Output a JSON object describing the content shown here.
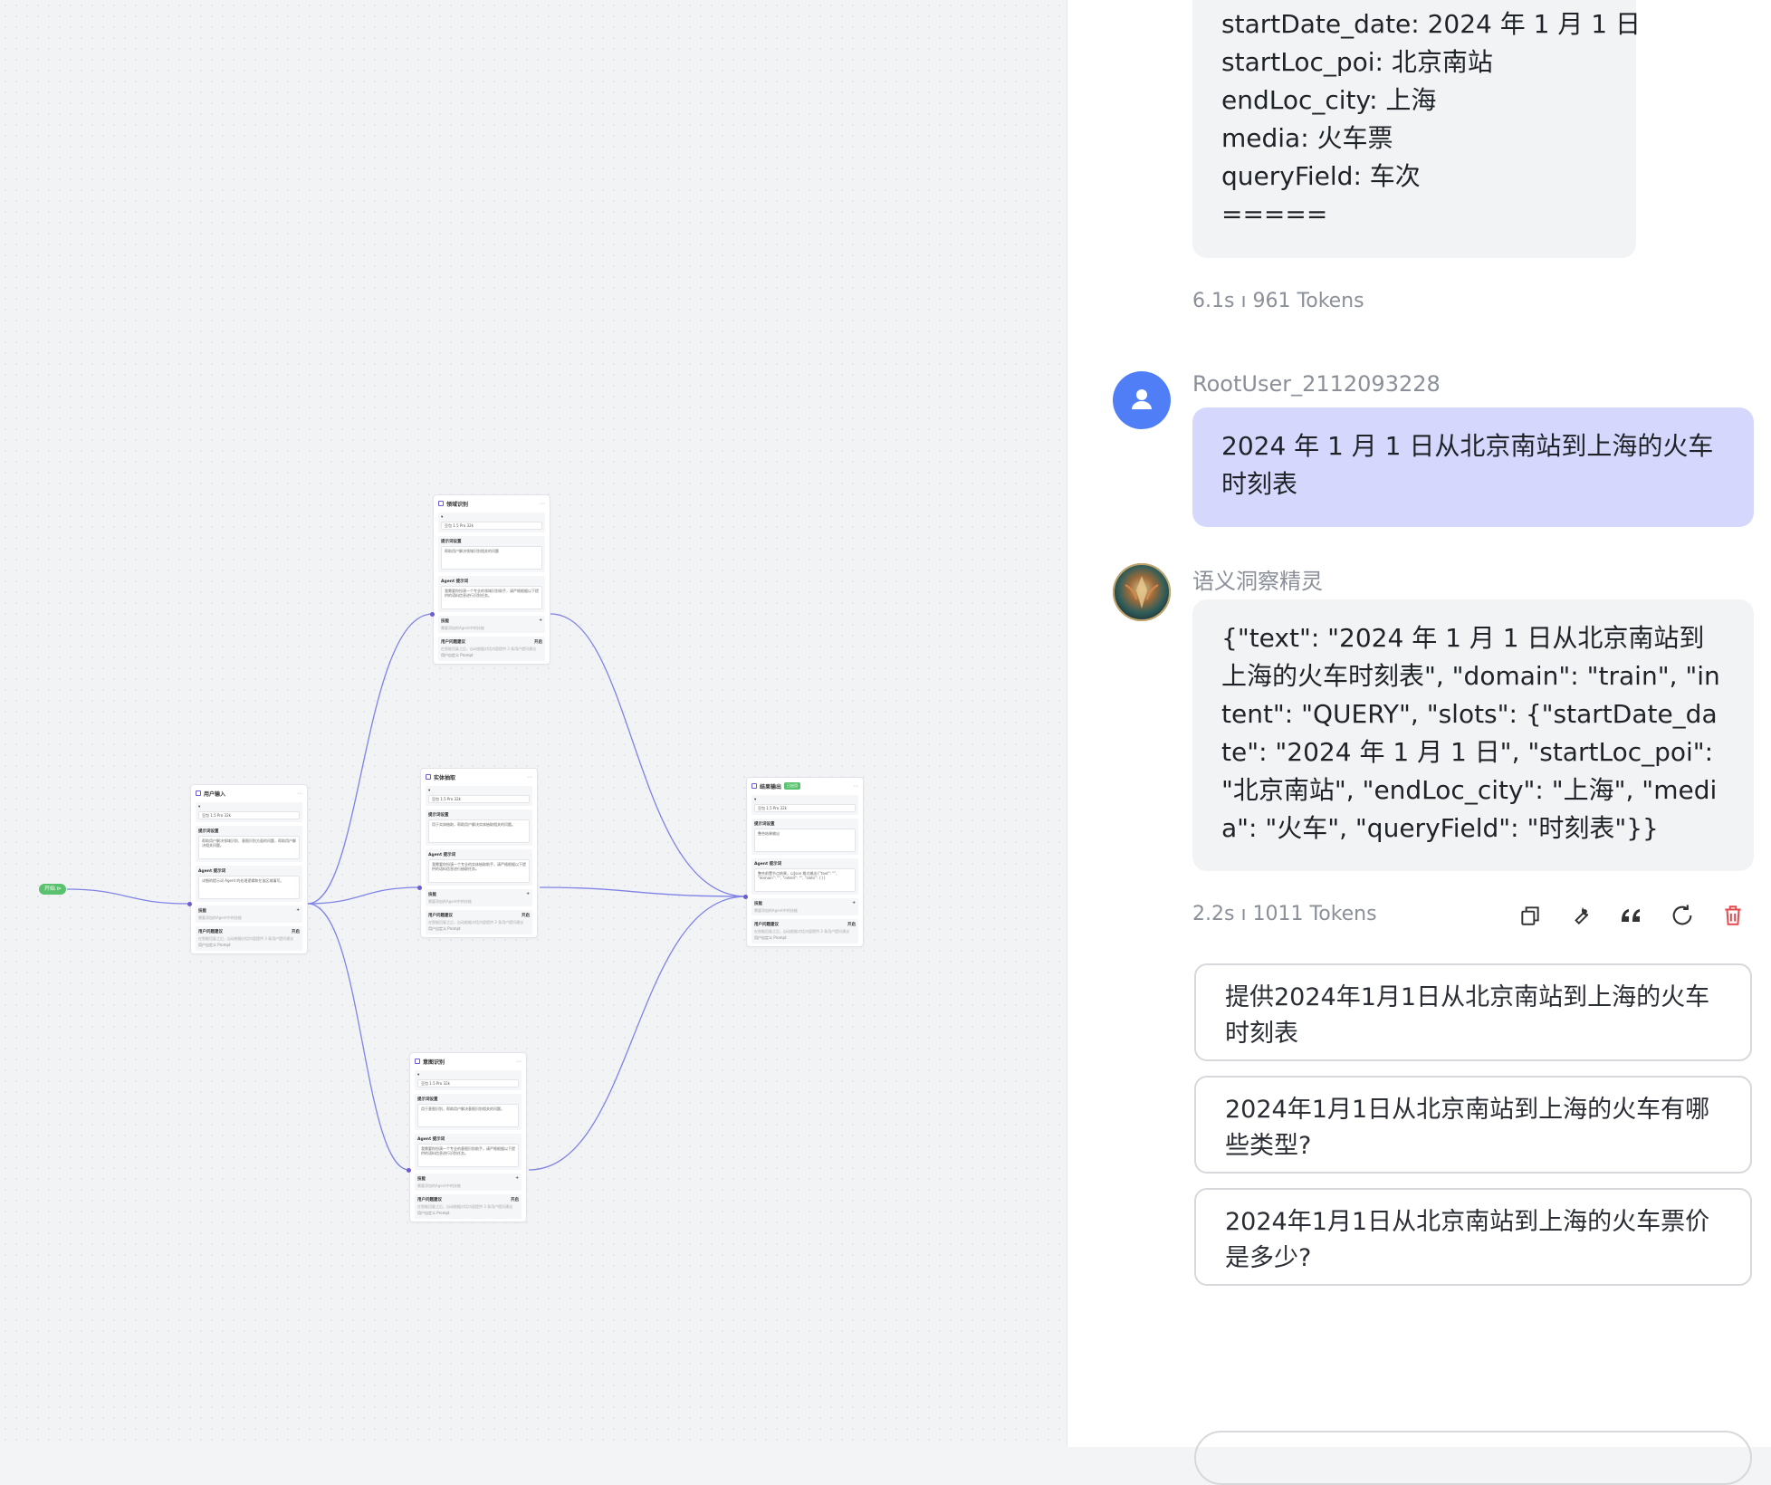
{
  "canvas": {
    "start_label": "开始 ⊳",
    "nodes": [
      {
        "id": "user",
        "title": "用户输入",
        "model": "豆包 1.5 Pro 32k",
        "prompt_label": "提示词设置",
        "prompt": "帮助用户解决领域识别、意图识别方面的问题，帮助用户解决相关问题。",
        "agent_label": "Agent 提示词",
        "agent": "详细的提示词 Agent 的处理逻辑和在该区域填写。",
        "skills_label": "技能",
        "skills_hint": "需要添加的Agent中的技能",
        "suggest_label": "用户问题建议",
        "suggest_state": "开启",
        "suggest_text": "在智能回复之后，自动根据对话内容提供 3 条用户提问建议",
        "custom": "用户自定义 Prompt"
      },
      {
        "id": "domain",
        "title": "领域识别",
        "model": "豆包 1.5 Pro 32k",
        "prompt_label": "提示词设置",
        "prompt": "帮助用户解决领域识别相关的问题",
        "agent_label": "Agent 提示词",
        "agent": "我需要你扮演一个专业的领域识别助手，请严格根据以下提供的语料信息进行识别任务。",
        "skills_label": "技能",
        "skills_hint": "需要添加的Agent中的技能",
        "suggest_label": "用户问题建议",
        "suggest_state": "开启",
        "suggest_text": "在智能回复之后，自动根据对话内容提供 3 条用户提问建议",
        "custom": "用户自定义 Prompt"
      },
      {
        "id": "slot",
        "title": "实体抽取",
        "model": "豆包 1.5 Pro 32k",
        "prompt_label": "提示词设置",
        "prompt": "用于实体抽取，帮助用户解决实体抽取相关的问题。",
        "agent_label": "Agent 提示词",
        "agent": "我需要你扮演一个专业的实体抽取助手，请严格根据以下提供的语料信息进行抽取任务。",
        "skills_label": "技能",
        "skills_hint": "需要添加的Agent中的技能",
        "suggest_label": "用户问题建议",
        "suggest_state": "开启",
        "suggest_text": "在智能回复之后，自动根据对话内容提供 3 条用户提问建议",
        "custom": "用户自定义 Prompt"
      },
      {
        "id": "intent",
        "title": "意图识别",
        "model": "豆包 1.5 Pro 32k",
        "prompt_label": "提示词设置",
        "prompt": "用于意图识别，帮助用户解决意图识别相关的问题。",
        "agent_label": "Agent 提示词",
        "agent": "我需要你扮演一个专业的意图识别助手，请严格根据以下提供的语料信息进行识别任务。",
        "skills_label": "技能",
        "skills_hint": "需要添加的Agent中的技能",
        "suggest_label": "用户问题建议",
        "suggest_state": "开启",
        "suggest_text": "在智能回复之后，自动根据对话内容提供 3 条用户提问建议",
        "custom": "用户自定义 Prompt"
      },
      {
        "id": "output",
        "title": "结果输出",
        "badge": "已启用",
        "model": "豆包 1.5 Pro 32k",
        "prompt_label": "提示词设置",
        "prompt": "整合结果输出",
        "agent_label": "Agent 提示词",
        "agent": "整合前置节点结果，以Json 格式输出{\"text\": \"\", \"domain\": \"\", \"intent\": \"\", \"slots\": {}}",
        "skills_label": "技能",
        "skills_hint": "需要添加的Agent中的技能",
        "suggest_label": "用户问题建议",
        "suggest_state": "开启",
        "suggest_text": "在智能回复之后，自动根据对话内容提供 3 条用户提问建议",
        "custom": "用户自定义 Prompt"
      }
    ]
  },
  "chat": {
    "prev_message_lines": [
      "startDate_date: 2024 年 1 月 1 日",
      "startLoc_poi: 北京南站",
      "endLoc_city: 上海",
      "media: 火车票",
      "queryField: 车次",
      "====="
    ],
    "prev_meta": "6.1s  ı  961 Tokens",
    "user_name": "RootUser_2112093228",
    "user_message": "2024 年 1 月 1 日从北京南站到上海的火车时刻表",
    "bot_name": "语义洞察精灵",
    "bot_message": "{\"text\": \"2024 年 1 月 1 日从北京南站到上海的火车时刻表\", \"domain\": \"train\", \"intent\": \"QUERY\", \"slots\": {\"startDate_date\": \"2024 年 1 月 1 日\", \"startLoc_poi\": \"北京南站\", \"endLoc_city\": \"上海\", \"media\": \"火车\", \"queryField\": \"时刻表\"}}",
    "bot_meta": "2.2s  ı  1011 Tokens",
    "suggestions": [
      "提供2024年1月1日从北京南站到上海的火车时刻表",
      "2024年1月1日从北京南站到上海的火车有哪些类型?",
      "2024年1月1日从北京南站到上海的火车票价是多少?"
    ],
    "colors": {
      "user_bubble": "#d5d8fc",
      "delete": "#e5484d",
      "avatar": "#4f7ef7"
    }
  }
}
